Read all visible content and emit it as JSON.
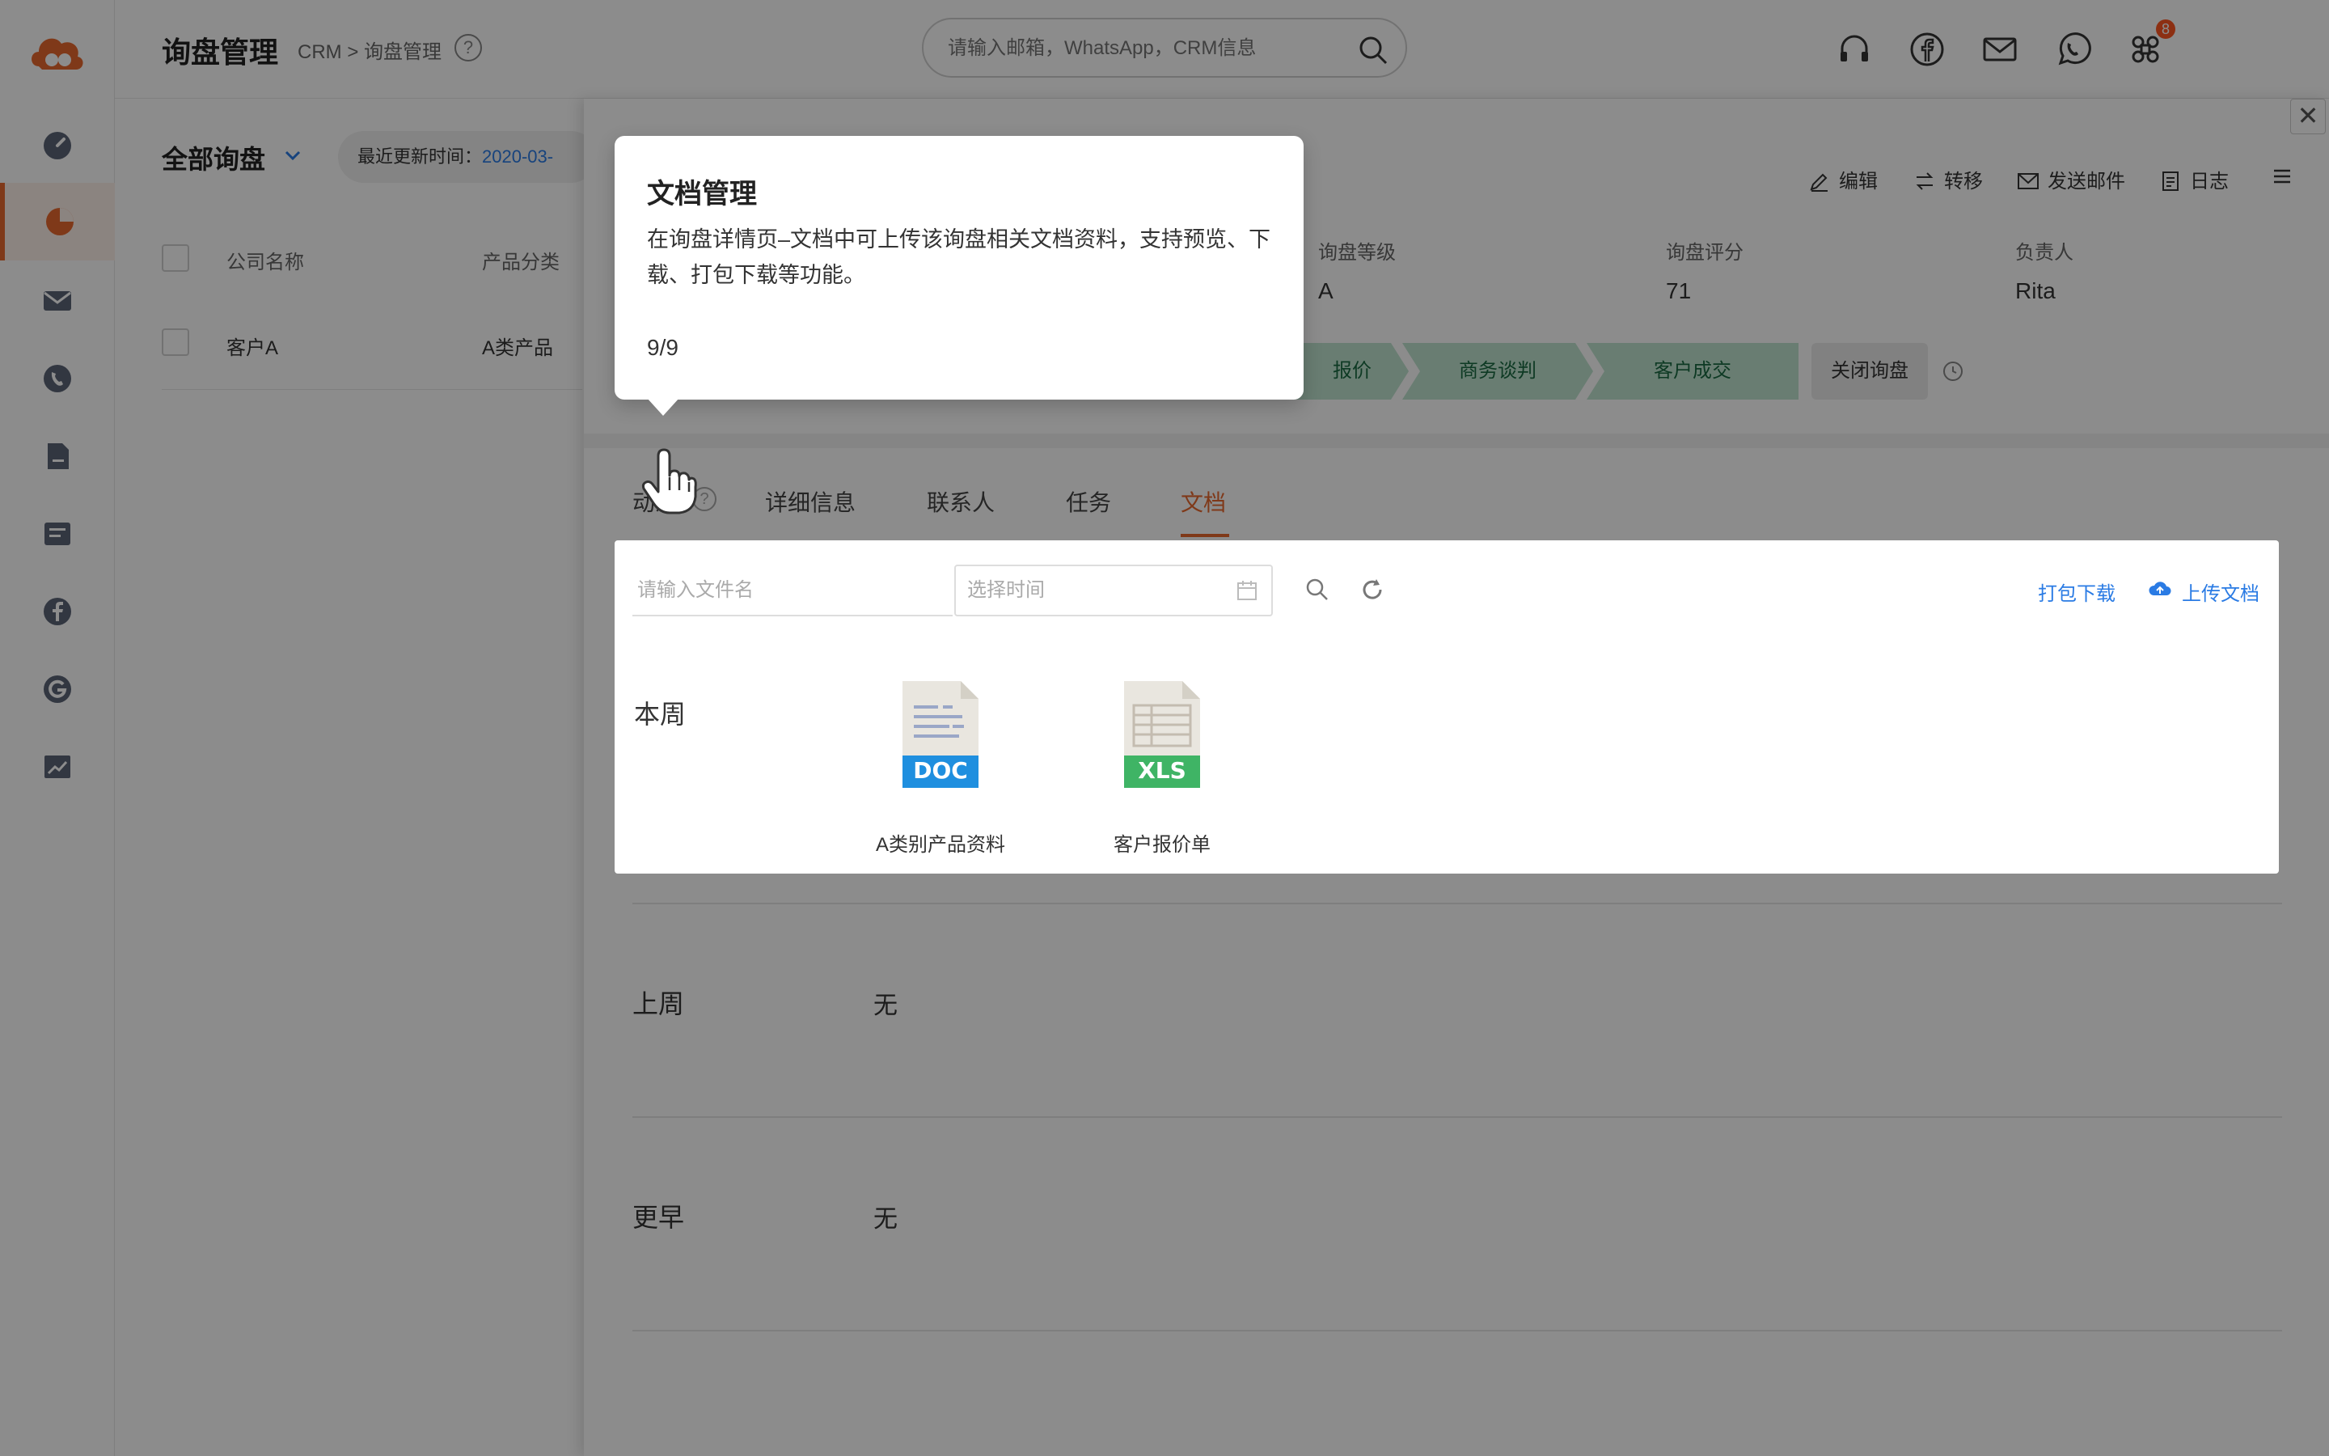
{
  "app": {
    "logo": "cloud-logo"
  },
  "sidebar": {
    "items": [
      {
        "icon": "dashboard-icon"
      },
      {
        "icon": "pie-chart-icon",
        "active": true
      },
      {
        "icon": "mail-icon"
      },
      {
        "icon": "phone-icon"
      },
      {
        "icon": "folder-icon"
      },
      {
        "icon": "chat-icon"
      },
      {
        "icon": "facebook-icon"
      },
      {
        "icon": "google-icon"
      },
      {
        "icon": "trend-chart-icon"
      }
    ]
  },
  "header": {
    "title": "询盘管理",
    "breadcrumb": "CRM > 询盘管理",
    "help": "?",
    "search_placeholder": "请输入邮箱，WhatsApp，CRM信息",
    "apps_badge": "8"
  },
  "list": {
    "filter_title": "全部询盘",
    "filter_chip_label": "最近更新时间：",
    "filter_chip_value": "2020-03-",
    "columns": [
      "公司名称",
      "产品分类"
    ],
    "rows": [
      {
        "company": "客户A",
        "product": "A类产品"
      }
    ]
  },
  "detail": {
    "close": "✕",
    "actions": {
      "edit": "编辑",
      "transfer": "转移",
      "send_email": "发送邮件",
      "log": "日志"
    },
    "info": [
      {
        "label": "询盘等级",
        "value": "A"
      },
      {
        "label": "询盘评分",
        "value": "71"
      },
      {
        "label": "负责人",
        "value": "Rita"
      }
    ],
    "stages": [
      "报价",
      "商务谈判",
      "客户成交"
    ],
    "close_inquiry": "关闭询盘",
    "tabs": [
      "动态",
      "详细信息",
      "联系人",
      "任务",
      "文档"
    ],
    "active_tab": "文档"
  },
  "documents": {
    "filename_placeholder": "请输入文件名",
    "date_placeholder": "选择时间",
    "pack_download": "打包下载",
    "upload": "上传文档",
    "this_week": "本周",
    "files": [
      {
        "name": "A类别产品资料",
        "type": "DOC",
        "color": "#1f8fdf"
      },
      {
        "name": "客户报价单",
        "type": "XLS",
        "color": "#3fb465"
      }
    ],
    "last_week": "上周",
    "last_week_value": "无",
    "earlier": "更早",
    "earlier_value": "无"
  },
  "tour": {
    "title": "文档管理",
    "body": "在询盘详情页–文档中可上传该询盘相关文档资料，支持预览、下载、打包下载等功能。",
    "step": "9/9"
  },
  "colors": {
    "accent": "#e8692f",
    "link": "#2a7be4",
    "stage": "#bfe3cf"
  }
}
